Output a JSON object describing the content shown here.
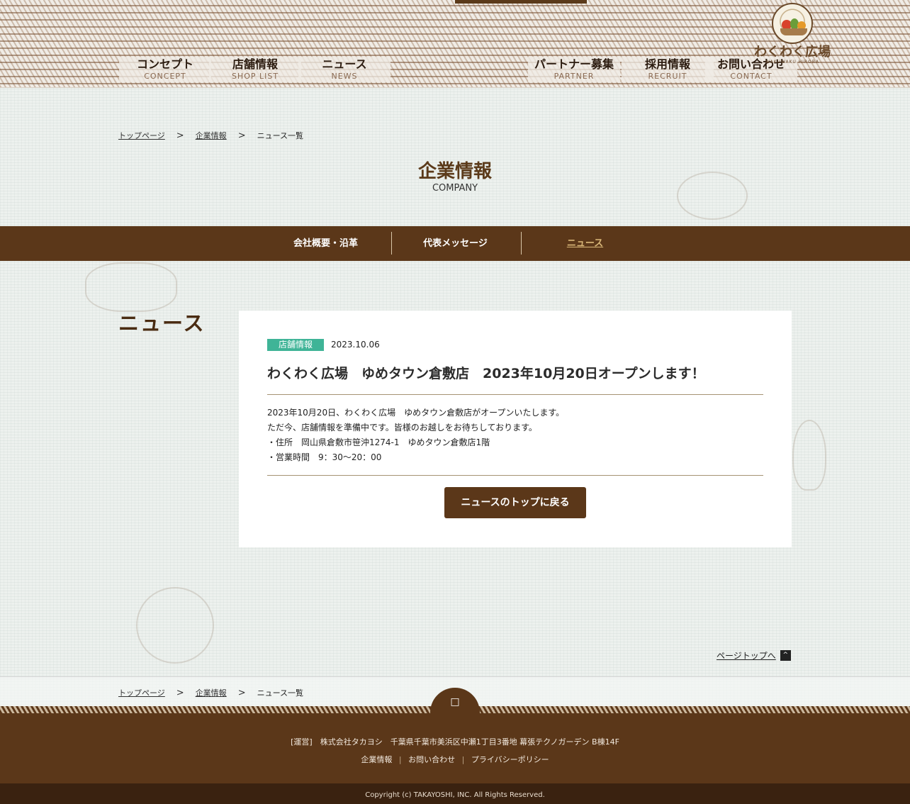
{
  "header": {
    "nav_left": [
      {
        "jp": "コンセプト",
        "en": "CONCEPT"
      },
      {
        "jp": "店舗情報",
        "en": "SHOP LIST"
      },
      {
        "jp": "ニュース",
        "en": "NEWS"
      }
    ],
    "nav_right": [
      {
        "jp": "パートナー募集",
        "en": "PARTNER"
      },
      {
        "jp": "採用情報",
        "en": "RECRUIT"
      },
      {
        "jp": "お問い合わせ",
        "en": "CONTACT"
      }
    ],
    "logo": {
      "name": "わくわく広場",
      "sub": "WAKUWAKU HIROBA"
    }
  },
  "breadcrumb": {
    "items": [
      "トップページ",
      "企業情報",
      "ニュース一覧"
    ],
    "separator": ">"
  },
  "page_title": {
    "jp": "企業情報",
    "en": "COMPANY"
  },
  "subnav": {
    "items": [
      "会社概要・沿革",
      "代表メッセージ",
      "ニュース"
    ]
  },
  "section_heading": "ニュース",
  "article": {
    "tag": "店舗情報",
    "date": "2023.10.06",
    "title": "わくわく広場　ゆめタウン倉敷店　2023年10月20日オープンします！",
    "body": [
      "2023年10月20日、わくわく広場　ゆめタウン倉敷店がオープンいたします。",
      "ただ今、店舗情報を準備中です。皆様のお越しをお待ちしております。",
      "・住所　岡山県倉敷市笹沖1274-1　ゆめタウン倉敷店1階",
      "・営業時間　9：30〜20：00"
    ],
    "back_button": "ニュースのトップに戻る"
  },
  "pagetop": {
    "label": "ページトップへ",
    "arrow": "^"
  },
  "footer": {
    "address": "[運営]　株式会社タカヨシ　千葉県千葉市美浜区中瀬1丁目3番地 幕張テクノガーデン B棟14F",
    "links": [
      "企業情報",
      "お問い合わせ",
      "プライバシーポリシー"
    ],
    "link_separator": "|",
    "copyright": "Copyright (c) TAKAYOSHI, INC. All Rights Reserved."
  },
  "colors": {
    "brand_brown": "#5b3719",
    "tag_green": "#3fb497",
    "active_gold": "#d9b778"
  }
}
